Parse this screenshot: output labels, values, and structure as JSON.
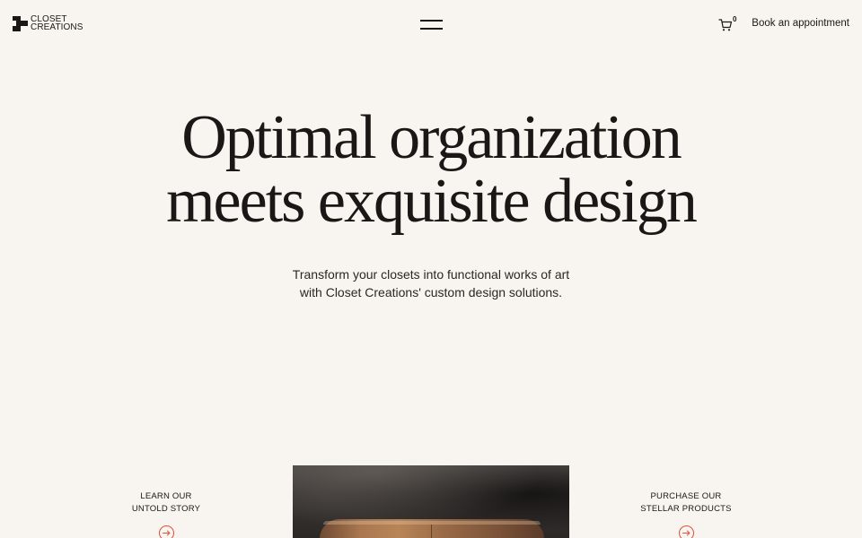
{
  "header": {
    "logo": {
      "line1": "CLOSET",
      "line2": "CREATIONS"
    },
    "menu_icon": "hamburger-menu-icon",
    "cart": {
      "icon": "cart-icon",
      "count": "0"
    },
    "book_label": "Book an appointment"
  },
  "hero": {
    "headline_line1": "Optimal organization",
    "headline_line2": "meets exquisite design",
    "subtext_line1": "Transform your closets into functional works of art",
    "subtext_line2": "with Closet Creations' custom design solutions."
  },
  "links": {
    "left": {
      "line1": "LEARN OUR",
      "line2": "UNTOLD STORY",
      "icon": "arrow-right-icon"
    },
    "right": {
      "line1": "PURCHASE OUR",
      "line2": "STELLAR PRODUCTS",
      "icon": "arrow-right-icon"
    }
  },
  "colors": {
    "background": "#f8f5f0",
    "text": "#1a1816",
    "accent": "#e0503c"
  }
}
